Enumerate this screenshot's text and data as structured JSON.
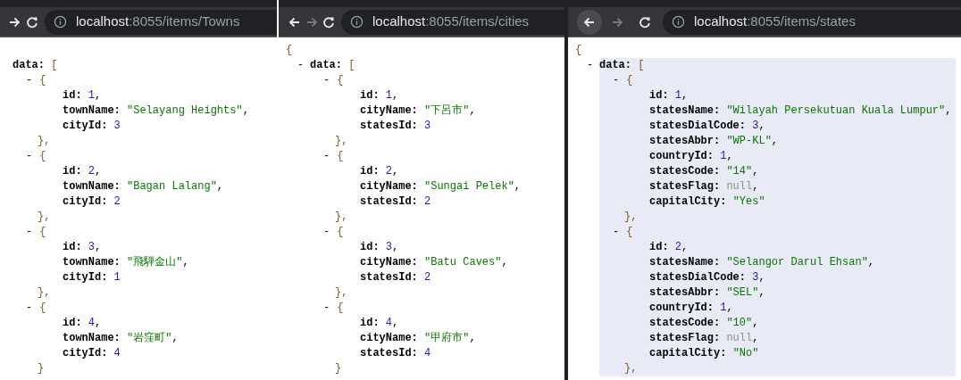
{
  "panels": [
    {
      "nav": {
        "forward": {
          "enabled": true
        },
        "reload": true
      },
      "address": {
        "host": "localhost",
        "path": ":8055/items/Towns"
      },
      "document": {
        "data": {
          "key": "data:",
          "open": "[",
          "highlighted": false,
          "items": [
            {
              "toggle": "-",
              "open": "{",
              "close": "},",
              "fields": [
                {
                  "key": "id:",
                  "value": "1",
                  "kind": "number",
                  "comma": ","
                },
                {
                  "key": "townName:",
                  "value": "\"Selayang Heights\"",
                  "kind": "string",
                  "comma": ","
                },
                {
                  "key": "cityId:",
                  "value": "3",
                  "kind": "number"
                }
              ]
            },
            {
              "toggle": "-",
              "open": "{",
              "close": "},",
              "fields": [
                {
                  "key": "id:",
                  "value": "2",
                  "kind": "number",
                  "comma": ","
                },
                {
                  "key": "townName:",
                  "value": "\"Bagan Lalang\"",
                  "kind": "string",
                  "comma": ","
                },
                {
                  "key": "cityId:",
                  "value": "2",
                  "kind": "number"
                }
              ]
            },
            {
              "toggle": "-",
              "open": "{",
              "close": "},",
              "fields": [
                {
                  "key": "id:",
                  "value": "3",
                  "kind": "number",
                  "comma": ","
                },
                {
                  "key": "townName:",
                  "value": "\"飛騨金山\"",
                  "kind": "string",
                  "comma": ","
                },
                {
                  "key": "cityId:",
                  "value": "1",
                  "kind": "number"
                }
              ]
            },
            {
              "toggle": "-",
              "open": "{",
              "close": "}",
              "fields": [
                {
                  "key": "id:",
                  "value": "4",
                  "kind": "number",
                  "comma": ","
                },
                {
                  "key": "townName:",
                  "value": "\"岩窪町\"",
                  "kind": "string",
                  "comma": ","
                },
                {
                  "key": "cityId:",
                  "value": "4",
                  "kind": "number"
                }
              ]
            }
          ]
        }
      }
    },
    {
      "nav": {
        "back": {
          "enabled": true,
          "hovered": false
        },
        "forward": {
          "enabled": false
        },
        "reload": true
      },
      "address": {
        "host": "localhost",
        "path": ":8055/items/cities"
      },
      "document": {
        "open": "{",
        "data": {
          "toggle": "-",
          "key": "data:",
          "open": "[",
          "highlighted": false,
          "items": [
            {
              "toggle": "-",
              "open": "{",
              "close": "},",
              "fields": [
                {
                  "key": "id:",
                  "value": "1",
                  "kind": "number",
                  "comma": ","
                },
                {
                  "key": "cityName:",
                  "value": "\"下呂市\"",
                  "kind": "string",
                  "comma": ","
                },
                {
                  "key": "statesId:",
                  "value": "3",
                  "kind": "number"
                }
              ]
            },
            {
              "toggle": "-",
              "open": "{",
              "close": "},",
              "fields": [
                {
                  "key": "id:",
                  "value": "2",
                  "kind": "number",
                  "comma": ","
                },
                {
                  "key": "cityName:",
                  "value": "\"Sungai Pelek\"",
                  "kind": "string",
                  "comma": ","
                },
                {
                  "key": "statesId:",
                  "value": "2",
                  "kind": "number"
                }
              ]
            },
            {
              "toggle": "-",
              "open": "{",
              "close": "},",
              "fields": [
                {
                  "key": "id:",
                  "value": "3",
                  "kind": "number",
                  "comma": ","
                },
                {
                  "key": "cityName:",
                  "value": "\"Batu Caves\"",
                  "kind": "string",
                  "comma": ","
                },
                {
                  "key": "statesId:",
                  "value": "2",
                  "kind": "number"
                }
              ]
            },
            {
              "toggle": "-",
              "open": "{",
              "close": "}",
              "fields": [
                {
                  "key": "id:",
                  "value": "4",
                  "kind": "number",
                  "comma": ","
                },
                {
                  "key": "cityName:",
                  "value": "\"甲府市\"",
                  "kind": "string",
                  "comma": ","
                },
                {
                  "key": "statesId:",
                  "value": "4",
                  "kind": "number"
                }
              ]
            }
          ]
        }
      }
    },
    {
      "nav": {
        "back": {
          "enabled": true,
          "hovered": true
        },
        "forward": {
          "enabled": false
        },
        "reload": true
      },
      "address": {
        "host": "localhost",
        "path": ":8055/items/states"
      },
      "document": {
        "open": "{",
        "data": {
          "toggle": "-",
          "key": "data:",
          "open": "[",
          "highlighted": true,
          "items": [
            {
              "toggle": "-",
              "open": "{",
              "close": "},",
              "fields": [
                {
                  "key": "id:",
                  "value": "1",
                  "kind": "number",
                  "comma": ","
                },
                {
                  "key": "statesName:",
                  "value": "\"Wilayah Persekutuan Kuala Lumpur\"",
                  "kind": "string",
                  "comma": ","
                },
                {
                  "key": "statesDialCode:",
                  "value": "3",
                  "kind": "number",
                  "comma": ","
                },
                {
                  "key": "statesAbbr:",
                  "value": "\"WP-KL\"",
                  "kind": "string",
                  "comma": ","
                },
                {
                  "key": "countryId:",
                  "value": "1",
                  "kind": "number",
                  "comma": ","
                },
                {
                  "key": "statesCode:",
                  "value": "\"14\"",
                  "kind": "string",
                  "comma": ","
                },
                {
                  "key": "statesFlag:",
                  "value": "null",
                  "kind": "null",
                  "comma": ","
                },
                {
                  "key": "capitalCity:",
                  "value": "\"Yes\"",
                  "kind": "string"
                }
              ]
            },
            {
              "toggle": "-",
              "open": "{",
              "close": "},",
              "fields": [
                {
                  "key": "id:",
                  "value": "2",
                  "kind": "number",
                  "comma": ","
                },
                {
                  "key": "statesName:",
                  "value": "\"Selangor Darul Ehsan\"",
                  "kind": "string",
                  "comma": ","
                },
                {
                  "key": "statesDialCode:",
                  "value": "3",
                  "kind": "number",
                  "comma": ","
                },
                {
                  "key": "statesAbbr:",
                  "value": "\"SEL\"",
                  "kind": "string",
                  "comma": ","
                },
                {
                  "key": "countryId:",
                  "value": "1",
                  "kind": "number",
                  "comma": ","
                },
                {
                  "key": "statesCode:",
                  "value": "\"10\"",
                  "kind": "string",
                  "comma": ","
                },
                {
                  "key": "statesFlag:",
                  "value": "null",
                  "kind": "null",
                  "comma": ","
                },
                {
                  "key": "capitalCity:",
                  "value": "\"No\"",
                  "kind": "string"
                }
              ]
            }
          ]
        }
      }
    }
  ]
}
